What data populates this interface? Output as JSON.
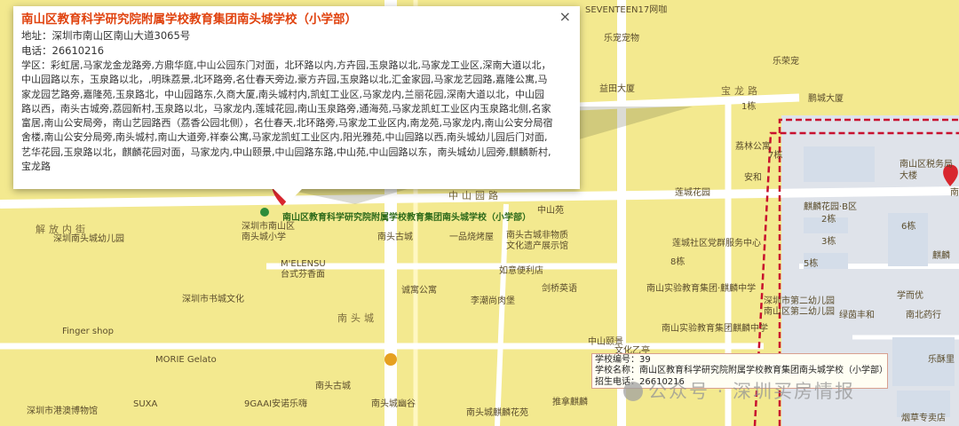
{
  "popup": {
    "title": "南山区教育科学研究院附属学校教育集团南头城学校（小学部）",
    "address": "地址：深圳市南山区南山大道3065号",
    "phone": "电话：26610216",
    "zone": "学区：彩虹居,马家龙金龙路旁,方鼎华庭,中山公园东门对面，北环路以内,方卉园,玉泉路以北,马家龙工业区,深南大道以北，中山园路以东，玉泉路以北，,明珠荔景,北环路旁,名仕春天旁边,豪方卉园,玉泉路以北,汇金家园,马家龙艺园路,嘉隆公寓,马家龙园艺路旁,嘉隆苑,玉泉路北，中山园路东,久商大厦,南头城村内,凯虹工业区,马家龙内,兰丽花园,深南大道以北，中山园路以西，南头古城旁,荔园新村,玉泉路以北，马家龙内,莲城花园,南山玉泉路旁,通海苑,马家龙凯虹工业区内玉泉路北侧,名家富居,南山公安局旁，南山艺园路西（荔香公园北侧），名仕春天,北环路旁,马家龙工业区内,南龙苑,马家龙内,南山公安分局宿舍楼,南山公安分局旁,南头城村,南山大道旁,祥泰公寓,马家龙凯虹工业区内,阳光雅苑,中山园路以西,南头城幼儿园后门对面,艺华花园,玉泉路以北，麒麟花园对面，马家龙内,中山颐景,中山园路东路,中山苑,中山园路以东，南头城幼儿园旁,麒麟新村,宝龙路",
    "close_glyph": "×"
  },
  "main_marker_label": "南山区教育科学研究院附属学校教育集团南头城学校（小学部）",
  "infobox": {
    "line1": "学校编号：39",
    "line2": "学校名称：南山区教育科学研究院附属学校教育集团南头城学校（小学部）",
    "line3": "招生电话：26610216"
  },
  "watermark": "公众号 · 深圳买房情报",
  "map_labels": [
    "SEVENTEEN17网咖",
    "乐宠宠物",
    "乐荣宠",
    "益田大厦",
    "宝龙路",
    "鹏城大厦",
    "南山区税务局",
    "大楼",
    "荔林公寓",
    "安和",
    "麒麟花园·B区",
    "莲城花园",
    "莲城社区党群服务中心",
    "中山苑",
    "中山园路",
    "深圳市南山区",
    "南头城小学",
    "南头古城",
    "一品烧烤屋",
    "南头古城非物质",
    "文化遗产展示馆",
    "解放内街",
    "深圳南头城幼儿园",
    "深圳市书城文化",
    "M'ELENSU",
    "台式芬香面",
    "如意便利店",
    "剑桥英语",
    "诚寓公寓",
    "李潮尚肉堡",
    "南头城",
    "Finger shop",
    "MORIE Gelato",
    "南头古城",
    "深圳市港澳博物馆",
    "SUXA",
    "9GAAI安诺乐嗨",
    "南头城幽谷",
    "南头城麒麟花苑",
    "推拿麒麟",
    "南山实验教育集团·麒麟中学",
    "南山实验教育集团麒麟中学",
    "南山区第二幼儿园",
    "绿茵丰和",
    "南北药行",
    "学而优",
    "深圳市第二幼儿园",
    "烟草专卖店",
    "乐酥里",
    "麒麟",
    "南",
    "2栋",
    "3栋",
    "5栋",
    "6栋",
    "1栋",
    "8栋",
    "7栋",
    "文化乙亭",
    "中山颐景"
  ],
  "colors": {
    "map_bg": "#f3e98f",
    "road": "#ffffff",
    "district_border": "#c8102e",
    "title": "#e0420e",
    "marker": "#d8262e",
    "green_label": "#2d6a1a"
  }
}
